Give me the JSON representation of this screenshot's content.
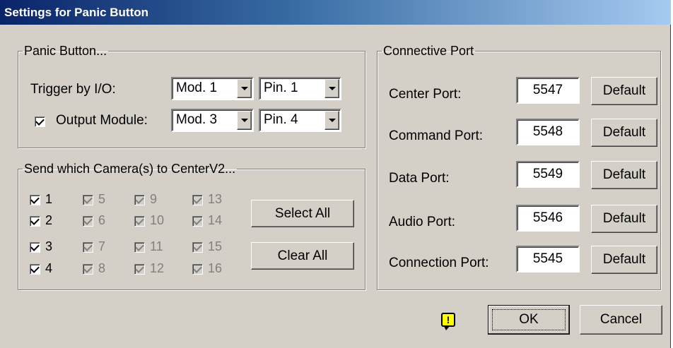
{
  "window": {
    "title": "Settings for Panic Button"
  },
  "panic_group": {
    "legend": "Panic Button...",
    "trigger_label": "Trigger by I/O:",
    "trigger_module": "Mod. 1",
    "trigger_pin": "Pin. 1",
    "output_checked": true,
    "output_label": "Output Module:",
    "output_module": "Mod. 3",
    "output_pin": "Pin. 4"
  },
  "camera_group": {
    "legend": "Send which Camera(s) to CenterV2...",
    "cameras": [
      {
        "label": "1",
        "checked": true,
        "enabled": true
      },
      {
        "label": "2",
        "checked": true,
        "enabled": true
      },
      {
        "label": "3",
        "checked": true,
        "enabled": true
      },
      {
        "label": "4",
        "checked": true,
        "enabled": true
      },
      {
        "label": "5",
        "checked": true,
        "enabled": false
      },
      {
        "label": "6",
        "checked": true,
        "enabled": false
      },
      {
        "label": "7",
        "checked": true,
        "enabled": false
      },
      {
        "label": "8",
        "checked": true,
        "enabled": false
      },
      {
        "label": "9",
        "checked": true,
        "enabled": false
      },
      {
        "label": "10",
        "checked": true,
        "enabled": false
      },
      {
        "label": "11",
        "checked": true,
        "enabled": false
      },
      {
        "label": "12",
        "checked": true,
        "enabled": false
      },
      {
        "label": "13",
        "checked": true,
        "enabled": false
      },
      {
        "label": "14",
        "checked": true,
        "enabled": false
      },
      {
        "label": "15",
        "checked": true,
        "enabled": false
      },
      {
        "label": "16",
        "checked": true,
        "enabled": false
      }
    ],
    "select_all_label": "Select All",
    "clear_all_label": "Clear All"
  },
  "ports_group": {
    "legend": "Connective Port",
    "default_label": "Default",
    "ports": [
      {
        "label": "Center Port:",
        "value": "5547"
      },
      {
        "label": "Command Port:",
        "value": "5548"
      },
      {
        "label": "Data Port:",
        "value": "5549"
      },
      {
        "label": "Audio Port:",
        "value": "5546"
      },
      {
        "label": "Connection Port:",
        "value": "5545"
      }
    ]
  },
  "footer": {
    "warning_glyph": "!",
    "ok_label": "OK",
    "cancel_label": "Cancel"
  },
  "colors": {
    "face": "#d4d0c8",
    "title_start": "#0a246a",
    "title_end": "#a6caf0",
    "warning": "#ffff00",
    "disabled_text": "#808080"
  }
}
